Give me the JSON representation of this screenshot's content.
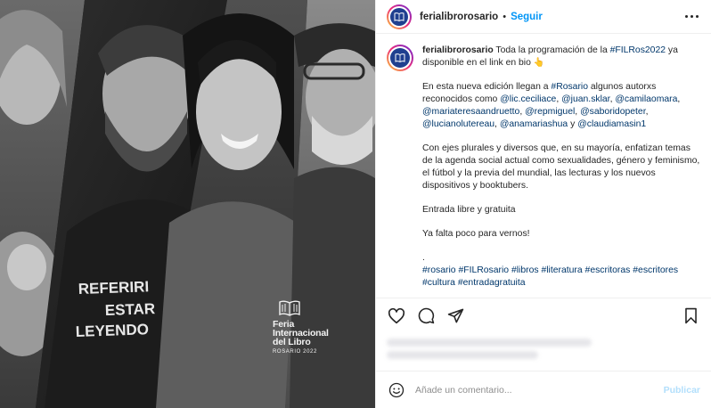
{
  "post": {
    "image": {
      "logo_title_lines": [
        "Feria",
        "Internacional",
        "del Libro"
      ],
      "logo_subtitle": "ROSARIO 2022",
      "shirt_text_lines": [
        "REFERIRI",
        "ESTAR",
        "LEYENDO"
      ]
    },
    "header": {
      "username": "ferialibrorosario",
      "separator": "•",
      "follow_label": "Seguir",
      "more_icon": "more-options-icon"
    },
    "caption": {
      "username": "ferialibrorosario",
      "p1_a": " Toda la programación de la ",
      "p1_tag": "#FILRos2022",
      "p1_b": " ya disponible en el link en bio ",
      "p1_emoji": "👆",
      "p2_a": "En esta nueva edición llegan a ",
      "p2_tag": "#Rosario",
      "p2_b": " algunos autorxs reconocidos como ",
      "mentions": [
        "@lic.ceciliace",
        "@juan.sklar",
        "@camilaomara",
        "@mariateresaandruetto",
        "@repmiguel",
        "@saboridopeter",
        "@lucianolutereau",
        "@anamariashua",
        "@claudiamasin1"
      ],
      "p3": "Con ejes plurales y diversos que, en su mayoría, enfatizan temas de la agenda social actual como sexualidades, género y feminismo, el fútbol y la previa del mundial, las lecturas y los nuevos dispositivos y booktubers.",
      "p4": "Entrada libre y gratuita",
      "p5": "Ya falta poco para vernos!",
      "p6": ".",
      "hashtags": [
        "#rosario",
        "#FILRosario",
        "#libros",
        "#literatura",
        "#escritoras",
        "#escritores",
        "#cultura",
        "#entradagratuita"
      ]
    },
    "actions": {
      "like_icon": "heart-icon",
      "comment_icon": "comment-icon",
      "share_icon": "share-icon",
      "save_icon": "bookmark-icon"
    },
    "comment_box": {
      "emoji_icon": "smiley-icon",
      "placeholder": "Añade un comentario...",
      "publish_label": "Publicar"
    },
    "colors": {
      "accent": "#0095f6",
      "link": "#00376b",
      "publish_disabled": "#b2dffc"
    }
  }
}
